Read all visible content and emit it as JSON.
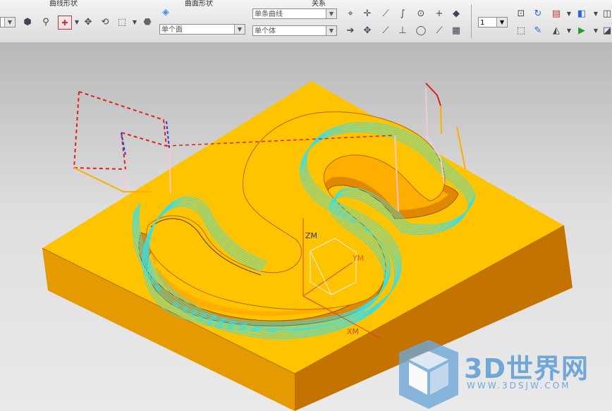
{
  "toolbar": {
    "captions": [
      "曲线形状",
      "曲面形状",
      "关系"
    ],
    "filter_curve": "单条曲线",
    "filter_face": "单个面",
    "filter_body": "单个体",
    "layer_value": "1"
  },
  "viewport": {
    "axis_labels": {
      "zm": "ZM",
      "ym": "YM",
      "xm": "XM"
    }
  },
  "watermark": {
    "main": "3D世界网",
    "url": "WWW.3DSJW.COM"
  },
  "colors": {
    "block_top": "#ffc400",
    "block_side_dark": "#c47a00",
    "block_side_light": "#f0a400",
    "toolpath": "#33e0ee",
    "rapid": "#e82020"
  }
}
